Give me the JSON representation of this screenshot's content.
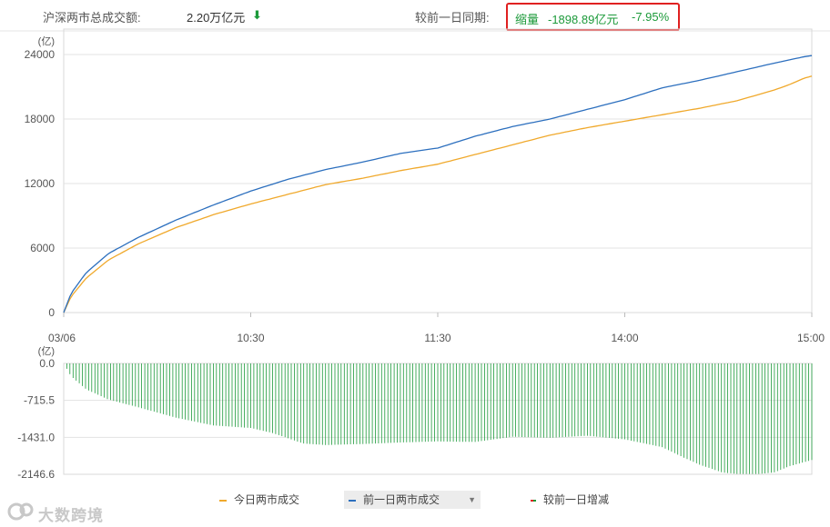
{
  "summary": {
    "label": "沪深两市总成交额:",
    "value": "2.20万亿元",
    "arrow": "⬇",
    "compare_label": "较前一日同期:",
    "shrink_label": "缩量",
    "shrink_amount": "-1898.89亿元",
    "shrink_pct": "-7.95%"
  },
  "colors": {
    "today": "#f0a92c",
    "prev": "#2c6fbe",
    "diff": "#1c9a3a",
    "highlight": "#e02020"
  },
  "chart_data": [
    {
      "type": "line",
      "ylabel": "(亿)",
      "x_ticks": [
        "03/06",
        "10:30",
        "11:30",
        "14:00",
        "15:00"
      ],
      "ylim": [
        0,
        24000
      ],
      "y_ticks": [
        "24000",
        "18000",
        "12000",
        "6000",
        "0"
      ],
      "grid": true,
      "x_frac": [
        0,
        0.01,
        0.03,
        0.06,
        0.1,
        0.15,
        0.2,
        0.25,
        0.3,
        0.35,
        0.4,
        0.45,
        0.5,
        0.55,
        0.6,
        0.65,
        0.7,
        0.75,
        0.8,
        0.85,
        0.9,
        0.95,
        0.97,
        0.99,
        1.0
      ],
      "series": [
        {
          "name": "今日两市成交",
          "key": "today",
          "values": [
            0,
            1500,
            3200,
            4900,
            6400,
            7900,
            9100,
            10100,
            11000,
            11900,
            12500,
            13200,
            13800,
            14700,
            15600,
            16500,
            17200,
            17800,
            18400,
            19000,
            19700,
            20700,
            21200,
            21800,
            22000
          ]
        },
        {
          "name": "前一日两市成交",
          "key": "prev",
          "values": [
            0,
            1800,
            3700,
            5500,
            7000,
            8600,
            10000,
            11300,
            12400,
            13300,
            14000,
            14800,
            15300,
            16400,
            17300,
            18000,
            18900,
            19800,
            20900,
            21600,
            22400,
            23200,
            23500,
            23800,
            23900
          ]
        }
      ]
    },
    {
      "type": "bar",
      "ylabel": "(亿)",
      "ylim": [
        -2146.6,
        0
      ],
      "y_ticks": [
        "0.0",
        "-715.5",
        "-1431.0",
        "-2146.6"
      ],
      "grid": true,
      "series": [
        {
          "name": "较前一日增减",
          "key": "diff",
          "x_frac": [
            0,
            0.01,
            0.03,
            0.06,
            0.1,
            0.15,
            0.2,
            0.25,
            0.28,
            0.3,
            0.32,
            0.35,
            0.4,
            0.45,
            0.5,
            0.55,
            0.6,
            0.65,
            0.7,
            0.75,
            0.8,
            0.83,
            0.85,
            0.88,
            0.9,
            0.93,
            0.95,
            0.97,
            1.0
          ],
          "values": [
            0,
            -250,
            -500,
            -700,
            -850,
            -1050,
            -1200,
            -1250,
            -1350,
            -1450,
            -1550,
            -1580,
            -1560,
            -1530,
            -1510,
            -1520,
            -1420,
            -1440,
            -1400,
            -1470,
            -1620,
            -1830,
            -1960,
            -2110,
            -2140,
            -2140,
            -2110,
            -1990,
            -1870
          ]
        }
      ]
    }
  ],
  "legend": {
    "today": "今日两市成交",
    "prev": "前一日两市成交",
    "diff": "较前一日增减"
  },
  "watermark": "大数跨境"
}
